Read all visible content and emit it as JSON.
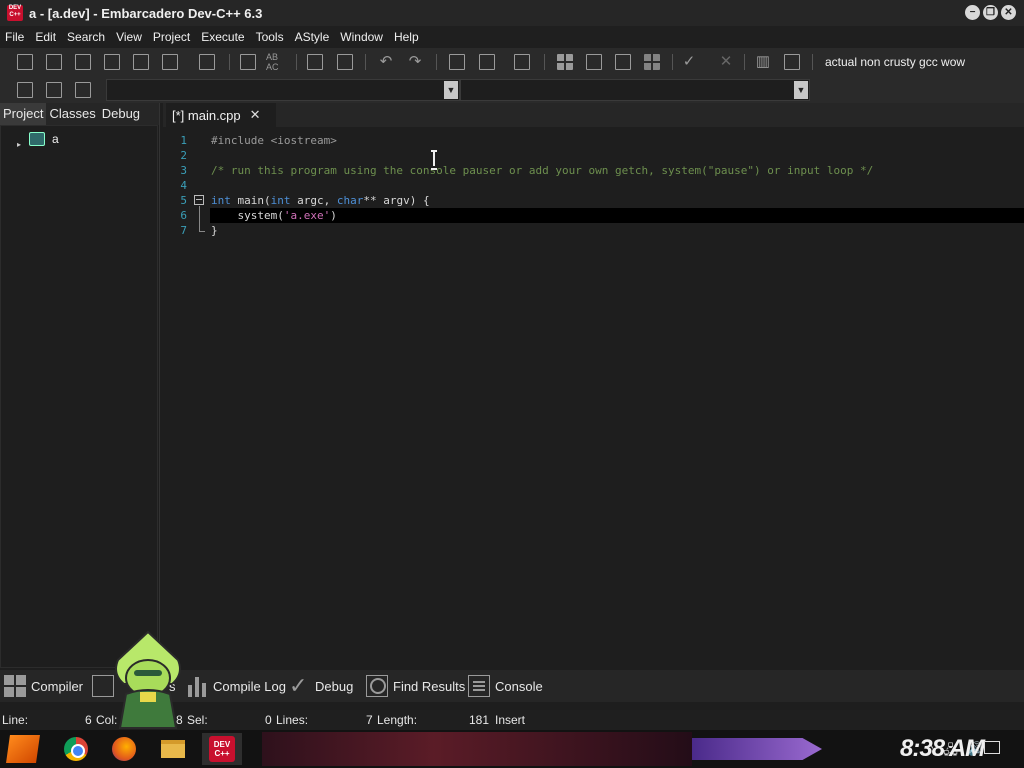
{
  "window": {
    "icon_text": "DEV C++",
    "title": "a - [a.dev] - Embarcadero Dev-C++ 6.3",
    "controls": [
      "−",
      "❐",
      "✕"
    ]
  },
  "menu": [
    "File",
    "Edit",
    "Search",
    "View",
    "Project",
    "Execute",
    "Tools",
    "AStyle",
    "Window",
    "Help"
  ],
  "toolbar": {
    "compiler_selection": "actual non crusty gcc wow",
    "replace_label": "AB AC"
  },
  "left_panel": {
    "tabs": [
      "Project",
      "Classes",
      "Debug"
    ],
    "active_tab": "Project",
    "tree": {
      "expander": "▸",
      "item": "a"
    }
  },
  "editor": {
    "tab_label": "[*] main.cpp",
    "tab_close": "✕",
    "line_numbers": [
      "1",
      "2",
      "3",
      "4",
      "5",
      "6",
      "7"
    ],
    "code": {
      "l1": "#include <iostream>",
      "l3": "/* run this program using the console pauser or add your own getch, system(\"pause\") or input loop */",
      "l5_kw1": "int",
      "l5_a": " main(",
      "l5_kw2": "int",
      "l5_b": " argc, ",
      "l5_kw3": "char",
      "l5_c": "** argv) {",
      "l6_a": "    system(",
      "l6_str": "'a.exe'",
      "l6_b": ")",
      "l7": "}"
    }
  },
  "bottom_tabs": {
    "compiler": "Compiler",
    "resources_partial": "s",
    "compile_log": "Compile Log",
    "debug": "Debug",
    "find_results": "Find Results",
    "console": "Console"
  },
  "status": {
    "line_label": "Line:",
    "line_value": "6",
    "col_label": "Col:",
    "col_value": "8",
    "sel_label": "Sel:",
    "sel_value": "0",
    "lines_label": "Lines:",
    "lines_value": "7",
    "length_label": "Length:",
    "length_value": "181",
    "mode": "Insert"
  },
  "taskbar": {
    "clock": "8:38 AM",
    "devcpp_text": "DEV C++",
    "tray_up": "^",
    "tray_network": "🖧",
    "tray_volume": "🔊"
  },
  "colors": {
    "accent": "#c8102e",
    "line_number": "#3a9fb8",
    "keyword": "#4d8fd6",
    "comment": "#6d8f4e",
    "string": "#d070b8"
  }
}
